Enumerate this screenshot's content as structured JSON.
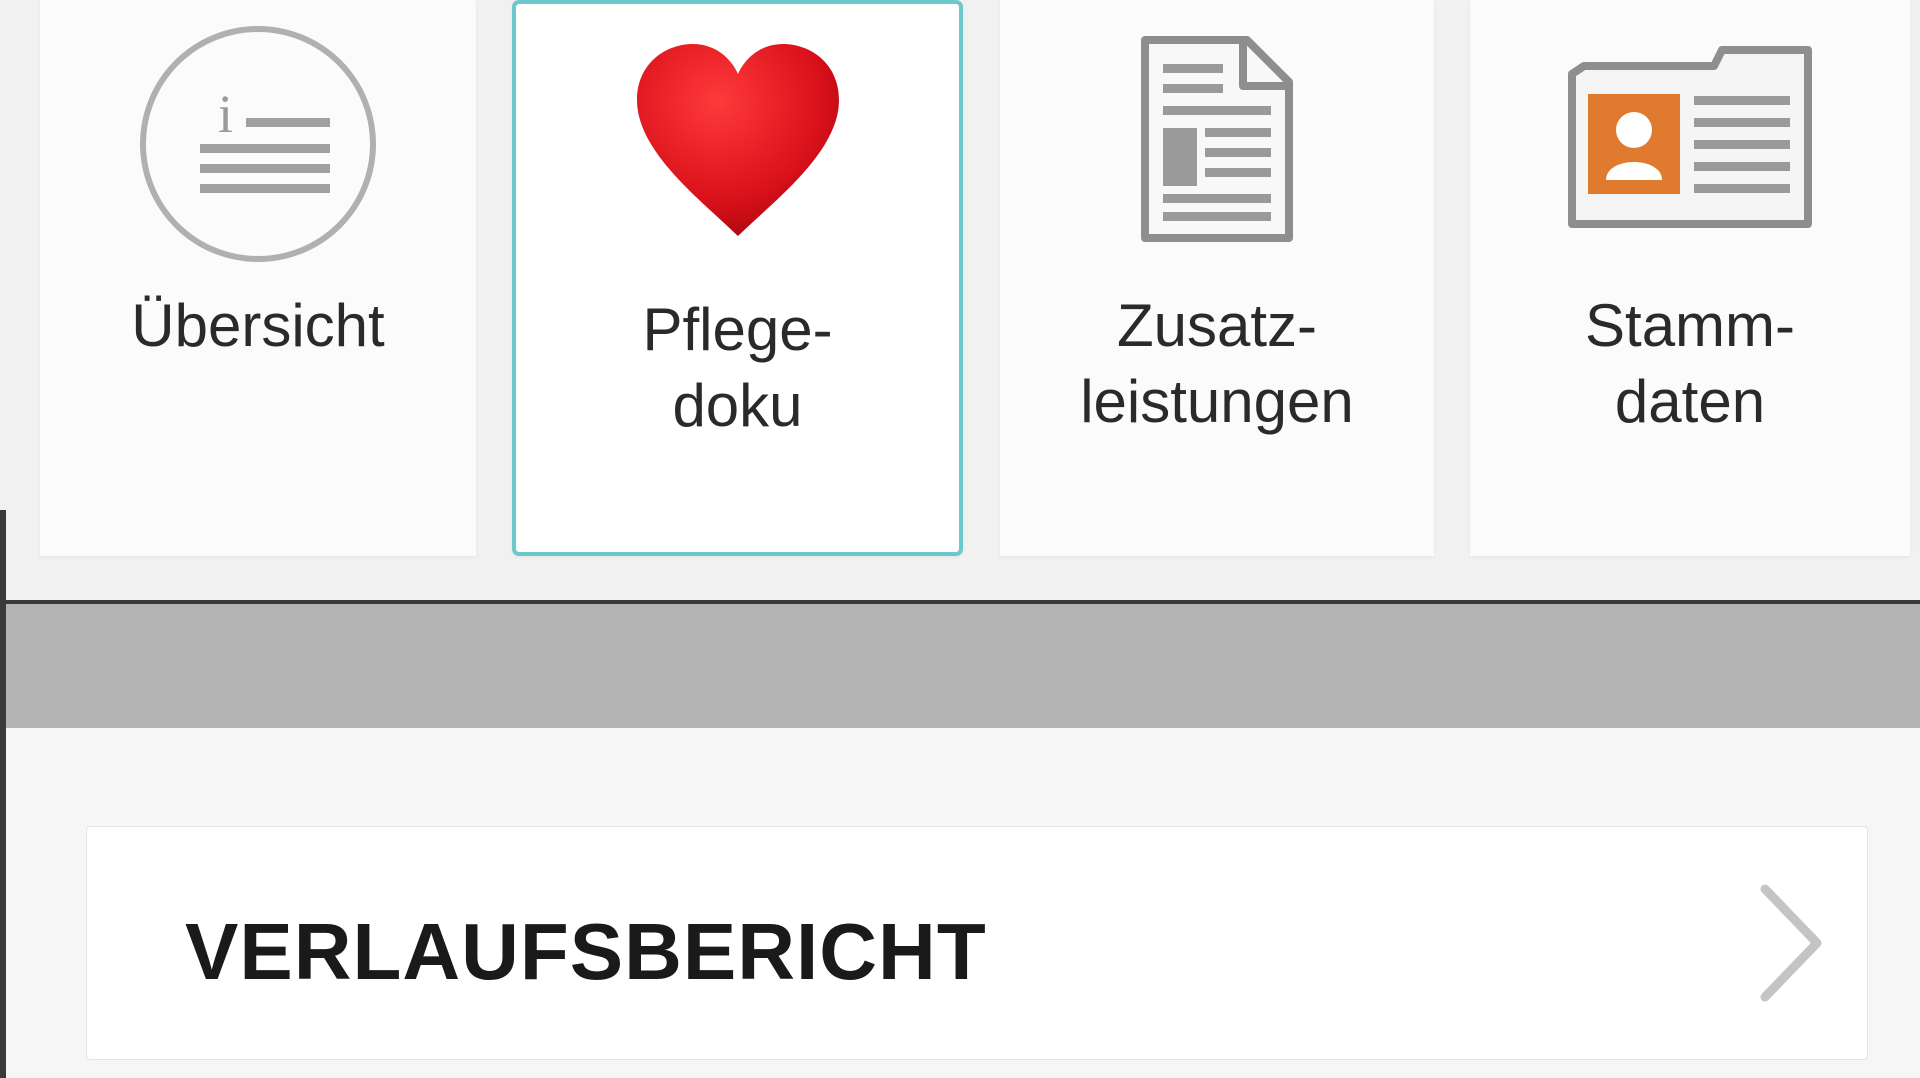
{
  "tiles": [
    {
      "id": "uebersicht",
      "label": "Übersicht",
      "icon": "info-list-icon",
      "selected": false
    },
    {
      "id": "pflegedoku",
      "label": "Pflege-\ndoku",
      "icon": "heart-icon",
      "selected": true
    },
    {
      "id": "zusatzleistungen",
      "label": "Zusatz-\nleistungen",
      "icon": "document-icon",
      "selected": false
    },
    {
      "id": "stammdaten",
      "label": "Stamm-\ndaten",
      "icon": "id-card-icon",
      "selected": false
    }
  ],
  "list": {
    "items": [
      {
        "label": "VERLAUFSBERICHT",
        "icon": "chevron-right-icon"
      }
    ]
  },
  "colors": {
    "selected_border": "#6dc8cc",
    "heart": "#d8101a",
    "id_card_accent": "#e07a2e",
    "band": "#b4b4b4"
  }
}
